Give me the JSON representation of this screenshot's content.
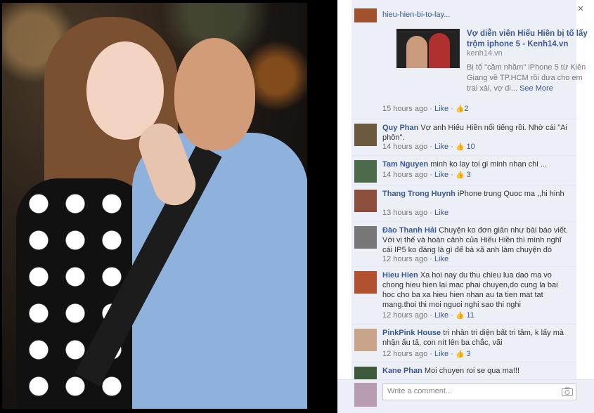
{
  "viewer": {
    "close_glyph": "×"
  },
  "shared_link": {
    "url_text": "hieu-hien-bi-to-lay...",
    "title": "Vợ diễn viên Hiếu Hiền bị tố lấy trộm iphone 5 - Kenh14.vn",
    "source": "kenh14.vn",
    "description": "Bị tố \"cầm nhầm\" iPhone 5 từ Kiên Giang về TP.HCM rồi đưa cho em trai xài, vợ di...",
    "see_more": "See More",
    "time": "15 hours ago",
    "like_label": "Like",
    "like_count": "2"
  },
  "comments": [
    {
      "name": "Quy Phan",
      "text": "Vợ anh Hiếu Hiền nổi tiếng rồi. Nhờ cái \"Ai phôn\".",
      "time": "14 hours ago",
      "like_label": "Like",
      "like_count": "10"
    },
    {
      "name": "Tam Nguyen",
      "text": "minh ko lay toi gi minh nhan chi ...",
      "time": "14 hours ago",
      "like_label": "Like",
      "like_count": "3"
    },
    {
      "name": "Thang Trong Huynh",
      "text": "iPhone trung Quoc ma ,,hi hinh",
      "time": "13 hours ago",
      "like_label": "Like",
      "like_count": ""
    },
    {
      "name": "Đào Thanh Hải",
      "text": "Chuyện ko đơn giản như bài báo viết. Với vị thế và hoàn cảnh của Hiếu Hiền thì mình nghĩ cái IP5 ko đáng là gì để bà xã anh làm chuyện đó",
      "time": "12 hours ago",
      "like_label": "Like",
      "like_count": ""
    },
    {
      "name": "Hieu Hien",
      "text": "Xa hoi nay du thu chieu lua dao ma vo chong hieu hien lai mac phai chuyen,do cung la bai hoc cho ba xa hieu hien nhan au ta tien mat tat mang.thoi thi moi nguoi nghi sao thi nghi",
      "time": "12 hours ago",
      "like_label": "Like",
      "like_count": "11"
    },
    {
      "name": "PinkPink House",
      "text": "tri nhân tri diện bất tri tâm, k lấy mà nhận ẩu tả, con nít lên ba chắc, vãi",
      "time": "12 hours ago",
      "like_label": "Like",
      "like_count": "3"
    },
    {
      "name": "Kane Phan",
      "text": "Moi chuyen roi se qua ma!!!",
      "time": "",
      "like_label": "",
      "like_count": ""
    }
  ],
  "composer": {
    "placeholder": "Write a comment...",
    "camera_icon": "camera-icon"
  },
  "colors": {
    "link_blue": "#3b5998",
    "comment_bg": "#eceff5",
    "meta_gray": "#777777"
  }
}
